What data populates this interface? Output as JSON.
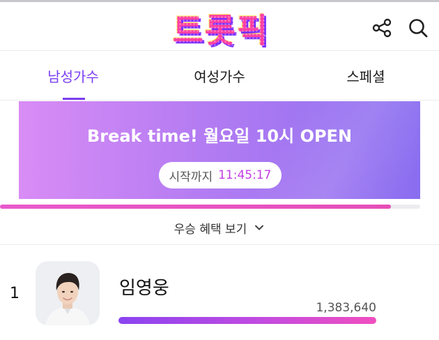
{
  "header": {
    "logo_text": "트롯픽",
    "share_icon": "share-icon",
    "search_icon": "search-icon"
  },
  "tabs": [
    {
      "label": "남성가수",
      "active": true
    },
    {
      "label": "여성가수",
      "active": false
    },
    {
      "label": "스페셜",
      "active": false
    }
  ],
  "banner": {
    "title": "Break time! 월요일 10시 OPEN",
    "countdown_label": "시작까지",
    "countdown_time": "11:45:17"
  },
  "progress": {
    "fraction": 0.93
  },
  "benefit": {
    "label": "우승 혜택 보기",
    "icon": "chevron-down-icon"
  },
  "ranking": [
    {
      "rank": "1",
      "name": "임영웅",
      "votes": "1,383,640",
      "bar_fraction": 1.0
    }
  ],
  "colors": {
    "accent": "#7b3ff2",
    "countdown": "#c23de3",
    "banner_start": "#d98cf5",
    "banner_end": "#8a6ef0",
    "progress": "#e85acb"
  }
}
